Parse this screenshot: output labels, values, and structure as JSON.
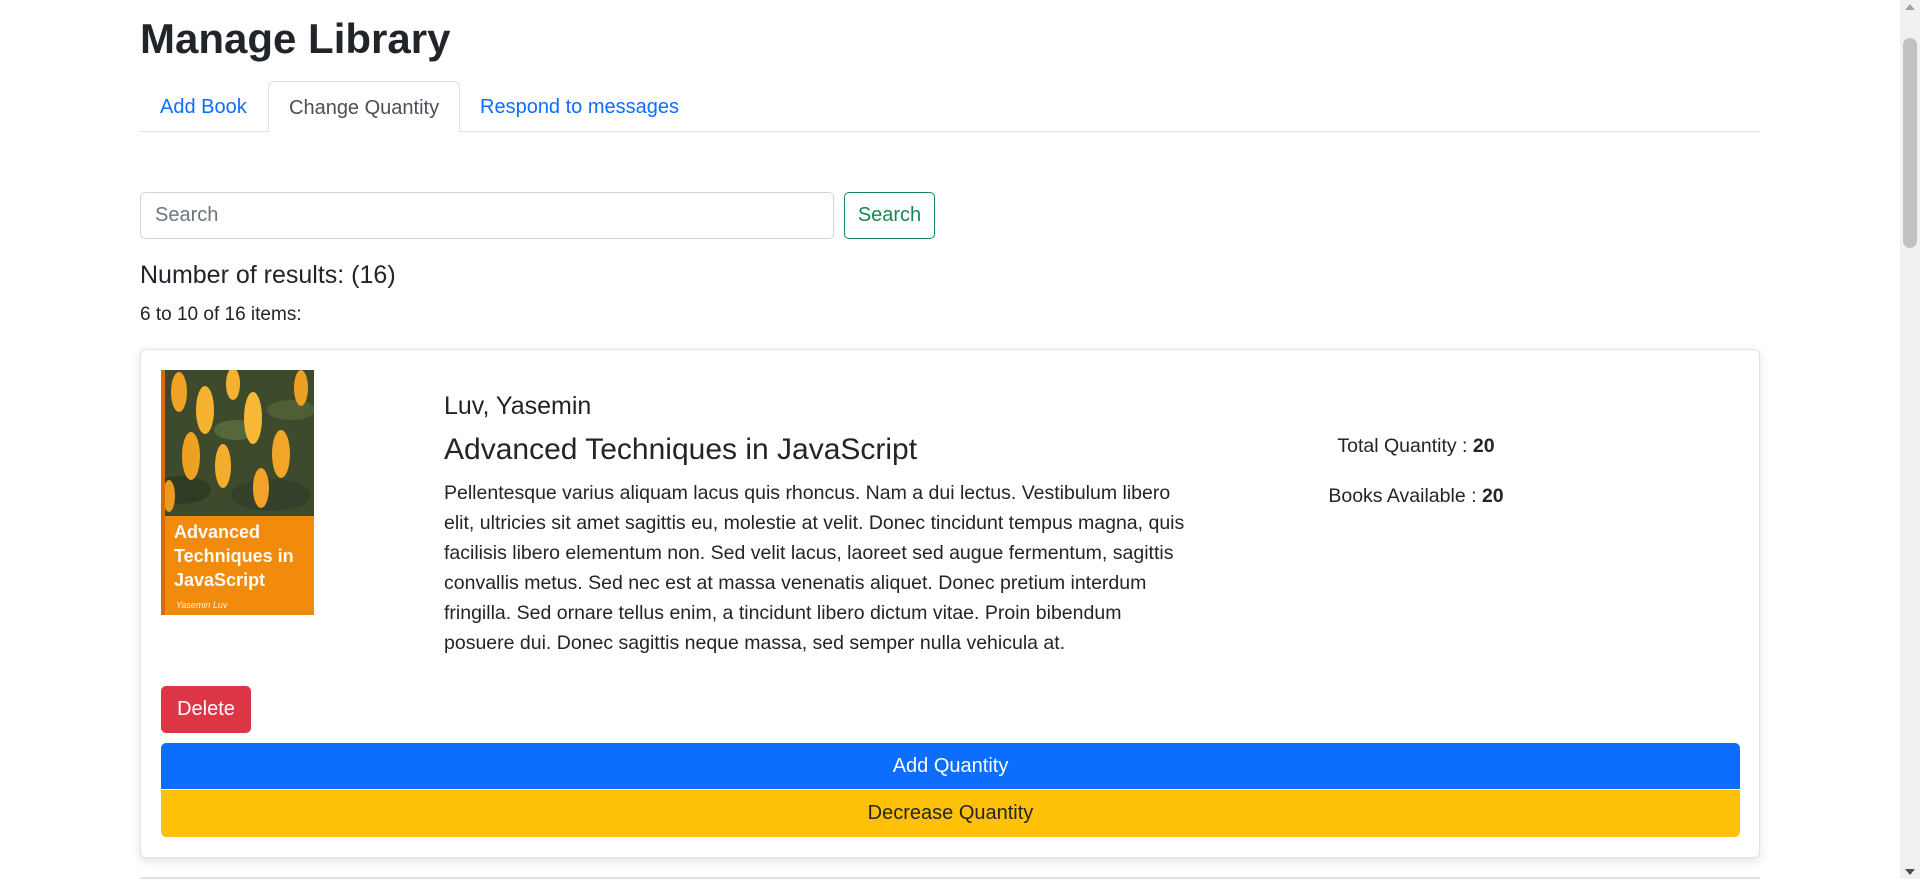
{
  "header": {
    "title": "Manage Library"
  },
  "tabs": [
    {
      "label": "Add Book",
      "active": false
    },
    {
      "label": "Change Quantity",
      "active": true
    },
    {
      "label": "Respond to messages",
      "active": false
    }
  ],
  "search": {
    "placeholder": "Search",
    "value": "",
    "button_label": "Search"
  },
  "results": {
    "count_label": "Number of results: (16)",
    "range_label": "6 to 10 of 16 items:"
  },
  "book": {
    "author": "Luv, Yasemin",
    "title": "Advanced Techniques in JavaScript",
    "description": "Pellentesque varius aliquam lacus quis rhoncus. Nam a dui lectus. Vestibulum libero elit, ultricies sit amet sagittis eu, molestie at velit. Donec tincidunt tempus magna, quis facilisis libero elementum non. Sed velit lacus, laoreet sed augue fermentum, sagittis convallis metus. Sed nec est at massa venenatis aliquet. Donec pretium interdum fringilla. Sed ornare tellus enim, a tincidunt libero dictum vitae. Proin bibendum posuere dui. Donec sagittis neque massa, sed semper nulla vehicula at.",
    "cover": {
      "title": "Advanced Techniques in JavaScript",
      "author": "Yasemin Luv"
    },
    "total_quantity_label": "Total Quantity :",
    "total_quantity": "20",
    "books_available_label": "Books Available :",
    "books_available": "20"
  },
  "actions": {
    "delete_label": "Delete",
    "add_quantity_label": "Add Quantity",
    "decrease_quantity_label": "Decrease Quantity"
  },
  "colors": {
    "primary": "#0d6efd",
    "danger": "#dc3545",
    "warning": "#ffc107",
    "success": "#198754"
  }
}
